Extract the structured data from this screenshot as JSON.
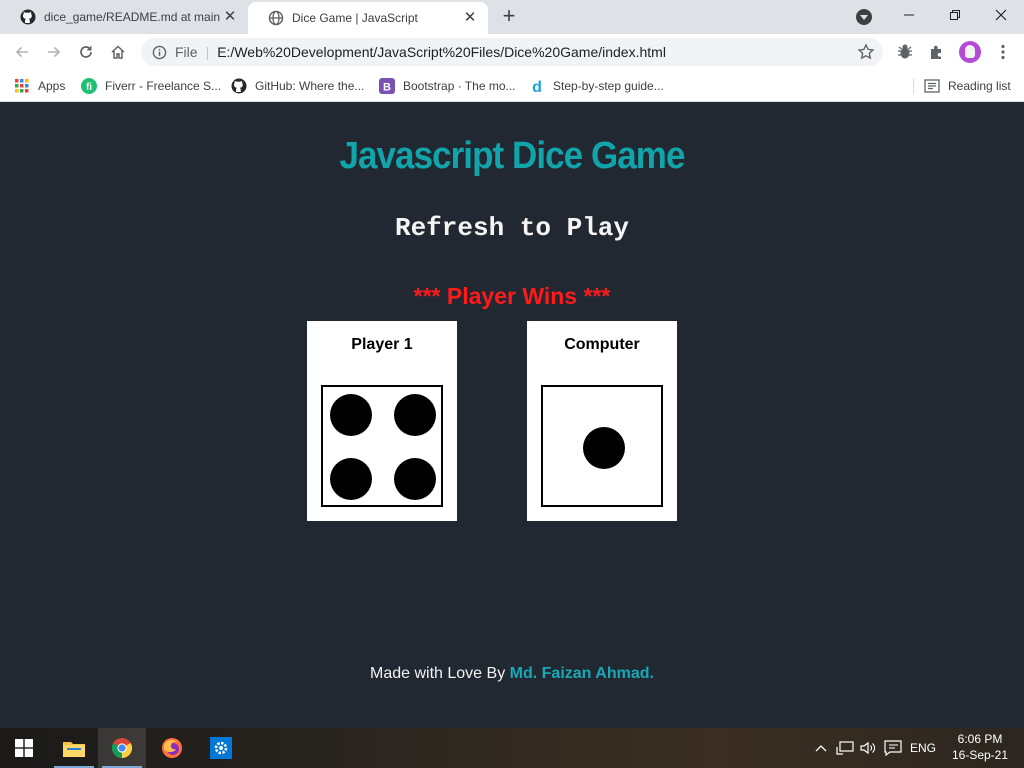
{
  "browser": {
    "tabs": [
      {
        "title": "dice_game/README.md at main",
        "icon": "github-icon",
        "active": false
      },
      {
        "title": "Dice Game | JavaScript",
        "icon": "globe-icon",
        "active": true
      }
    ],
    "address": {
      "scheme_label": "File",
      "url": "E:/Web%20Development/JavaScript%20Files/Dice%20Game/index.html"
    },
    "bookmarks": [
      {
        "label": "Apps",
        "icon": "apps-grid-icon"
      },
      {
        "label": "Fiverr - Freelance S...",
        "icon": "fiverr-icon"
      },
      {
        "label": "GitHub: Where the...",
        "icon": "github-icon"
      },
      {
        "label": "Bootstrap · The mo...",
        "icon": "bootstrap-icon"
      },
      {
        "label": "Step-by-step guide...",
        "icon": "d-icon"
      }
    ],
    "reading_list": "Reading list"
  },
  "page": {
    "title": "Javascript Dice Game",
    "subtitle": "Refresh to Play",
    "result": "*** Player Wins ***",
    "players": [
      {
        "label": "Player 1",
        "dice_value": 4
      },
      {
        "label": "Computer",
        "dice_value": 1
      }
    ],
    "footer": {
      "prefix": "Made with Love By",
      "author": "Md. Faizan Ahmad."
    }
  },
  "colors": {
    "background": "#222831",
    "title": "#10a5ab",
    "result": "#ff1a1a",
    "author": "#18a8b6"
  },
  "taskbar": {
    "apps": [
      "file-explorer-icon",
      "chrome-icon",
      "firefox-icon",
      "settings-icon"
    ],
    "language": "ENG",
    "time": "6:06 PM",
    "date": "16-Sep-21"
  }
}
